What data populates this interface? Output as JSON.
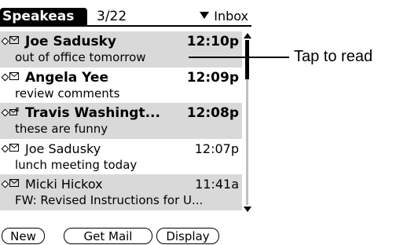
{
  "header": {
    "app_title": "Speakeas",
    "counter": "3/22",
    "folder": "Inbox"
  },
  "messages": [
    {
      "sender": "Joe Sadusky",
      "time": "12:10p",
      "subject": "out of office tomorrow",
      "unread": true,
      "highlighted": true,
      "icon": "envelope-icon"
    },
    {
      "sender": "Angela Yee",
      "time": "12:09p",
      "subject": "review comments",
      "unread": true,
      "highlighted": false,
      "icon": "envelope-icon"
    },
    {
      "sender": "Travis Washingt...",
      "time": "12:08p",
      "subject": "these are funny",
      "unread": true,
      "highlighted": true,
      "icon": "envelope-attachment-icon"
    },
    {
      "sender": "Joe Sadusky",
      "time": "12:07p",
      "subject": "lunch meeting today",
      "unread": false,
      "highlighted": false,
      "icon": "envelope-icon"
    },
    {
      "sender": "Micki Hickox",
      "time": "11:41a",
      "subject": "FW: Revised Instructions for U...",
      "unread": false,
      "highlighted": true,
      "icon": "envelope-icon"
    }
  ],
  "buttons": {
    "new": "New",
    "get_mail": "Get Mail",
    "display": "Display"
  },
  "callout": {
    "text": "Tap to read"
  }
}
